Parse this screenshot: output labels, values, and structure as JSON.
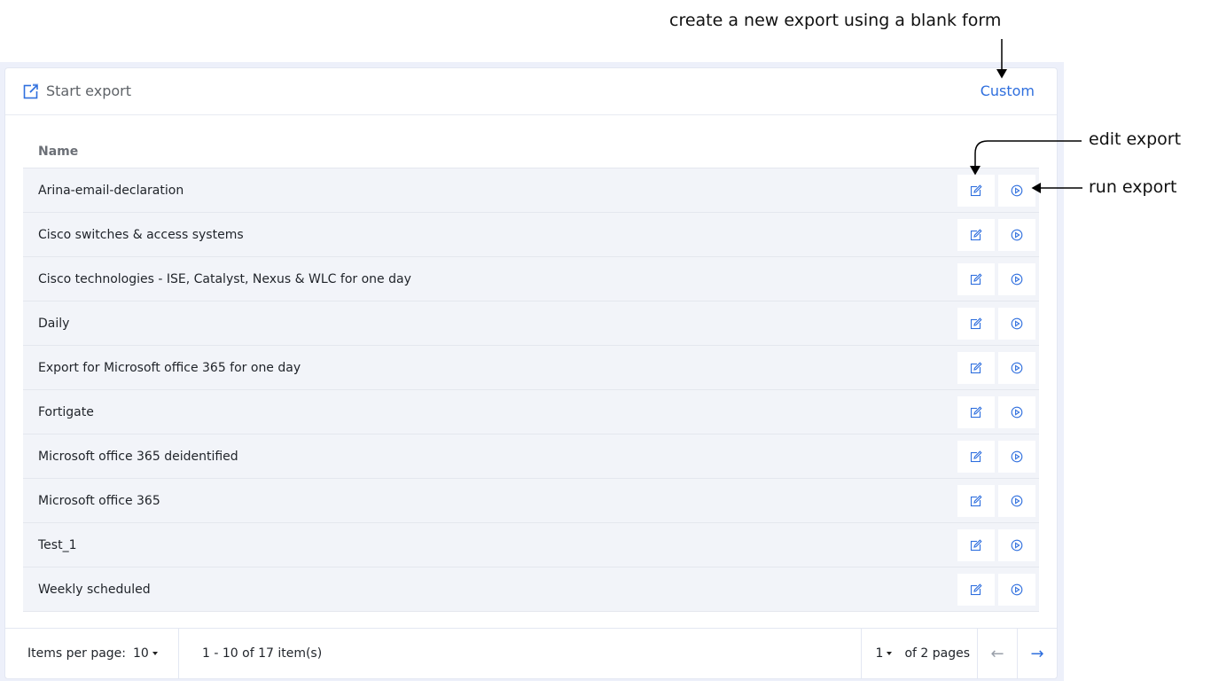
{
  "annotations": {
    "custom": "create a new export using a blank form",
    "edit": "edit export",
    "run": "run export"
  },
  "header": {
    "start_export_label": "Start export",
    "start_export_icon": "external-link-icon",
    "custom_label": "Custom"
  },
  "table": {
    "column_name": "Name",
    "rows": [
      {
        "name": "Arina-email-declaration"
      },
      {
        "name": "Cisco switches & access systems"
      },
      {
        "name": "Cisco technologies - ISE, Catalyst, Nexus & WLC for one day"
      },
      {
        "name": "Daily"
      },
      {
        "name": "Export for Microsoft office 365 for one day"
      },
      {
        "name": "Fortigate"
      },
      {
        "name": "Microsoft office 365 deidentified"
      },
      {
        "name": "Microsoft office 365"
      },
      {
        "name": "Test_1"
      },
      {
        "name": "Weekly scheduled"
      }
    ],
    "row_actions": [
      "edit-icon",
      "play-circle-icon"
    ]
  },
  "pager": {
    "items_per_page_label": "Items per page:",
    "items_per_page_value": "10",
    "count_text": "1 - 10 of 17 item(s)",
    "page_value": "1",
    "page_total_text": "of 2 pages",
    "prev_icon": "arrow-left-icon",
    "next_icon": "arrow-right-icon"
  },
  "colors": {
    "accent": "#2f6fde",
    "row_bg": "#f2f4f9",
    "panel_bg": "#edf0fa"
  }
}
